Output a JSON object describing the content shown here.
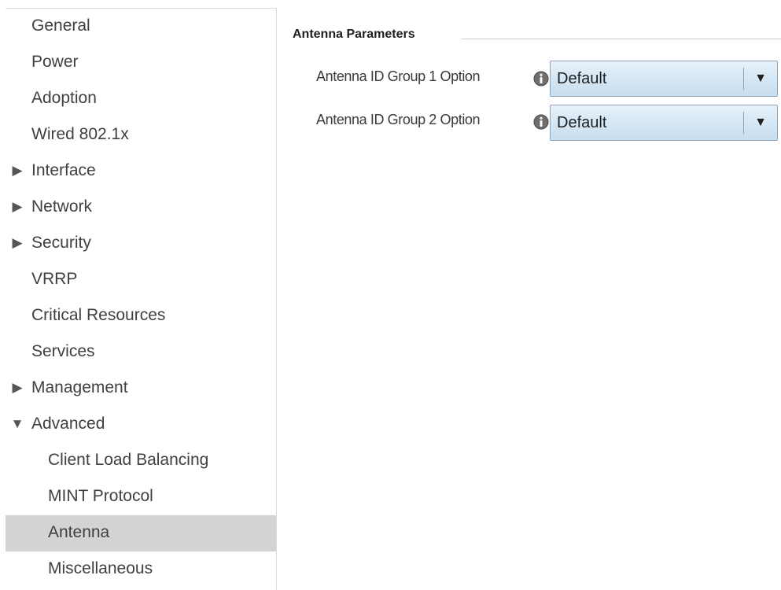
{
  "sidebar": {
    "items": [
      {
        "label": "General",
        "arrow": ""
      },
      {
        "label": "Power",
        "arrow": ""
      },
      {
        "label": "Adoption",
        "arrow": ""
      },
      {
        "label": "Wired 802.1x",
        "arrow": ""
      },
      {
        "label": "Interface",
        "arrow": "▶"
      },
      {
        "label": "Network",
        "arrow": "▶"
      },
      {
        "label": "Security",
        "arrow": "▶"
      },
      {
        "label": "VRRP",
        "arrow": ""
      },
      {
        "label": "Critical Resources",
        "arrow": ""
      },
      {
        "label": "Services",
        "arrow": ""
      },
      {
        "label": "Management",
        "arrow": "▶"
      },
      {
        "label": "Advanced",
        "arrow": "▼"
      },
      {
        "label": "Client Load Balancing",
        "arrow": ""
      },
      {
        "label": "MINT Protocol",
        "arrow": ""
      },
      {
        "label": "Antenna",
        "arrow": ""
      },
      {
        "label": "Miscellaneous",
        "arrow": ""
      }
    ],
    "selected": "Antenna"
  },
  "main": {
    "section_title": "Antenna Parameters",
    "fields": [
      {
        "label": "Antenna ID Group 1 Option",
        "value": "Default",
        "icon": "info-icon"
      },
      {
        "label": "Antenna ID Group 2 Option",
        "value": "Default",
        "icon": "info-icon"
      }
    ]
  },
  "colors": {
    "selected_row": "#d3d3d3",
    "dropdown_gradient_top": "#e6f1fa",
    "dropdown_gradient_bottom": "#c6ddef",
    "dropdown_border": "#8ea3b8"
  }
}
